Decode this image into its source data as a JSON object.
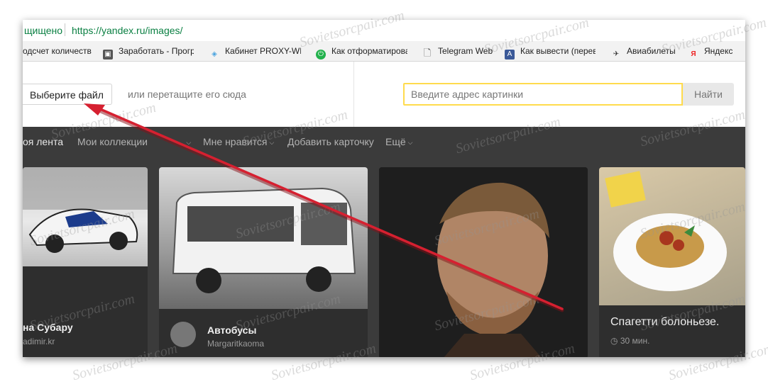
{
  "browser": {
    "secure_text": "щищено",
    "url": "https://yandex.ru/images/"
  },
  "bookmarks": [
    {
      "label": "одсчет количеств",
      "icon": "none"
    },
    {
      "label": "Заработать - Прогр",
      "icon": "page-icon"
    },
    {
      "label": "Кабинет PROXY-WE",
      "icon": "cube-icon"
    },
    {
      "label": "Как отформатирова",
      "icon": "power-icon"
    },
    {
      "label": "Telegram Web",
      "icon": "document-icon"
    },
    {
      "label": "Как вывести (перев",
      "icon": "a-letter-icon"
    },
    {
      "label": "Авиабилеты",
      "icon": "plane-icon"
    },
    {
      "label": "Яндекс",
      "icon": "yandex-icon"
    }
  ],
  "upload": {
    "choose_file_label": "Выберите файл",
    "drag_hint": "или перетащите его сюда"
  },
  "url_search": {
    "placeholder": "Введите адрес картинки",
    "button_label": "Найти"
  },
  "tabs": [
    {
      "label": "оя лента",
      "active": true
    },
    {
      "label": "Мои коллекции"
    },
    {
      "label": "Мне нравится"
    },
    {
      "label": "Добавить карточку"
    },
    {
      "label": "Ещё"
    }
  ],
  "cards": [
    {
      "title": "на Субару",
      "subtitle": "adimir.kr"
    },
    {
      "title": "Автобусы",
      "subtitle": "Margaritkaoma"
    },
    {
      "title": "",
      "subtitle": ""
    },
    {
      "title": "Спагетти болоньезе.",
      "subtitle": "30 мин."
    }
  ],
  "watermark": "Sovietsorcpair.com",
  "colors": {
    "secure_green": "#0b8043",
    "input_border": "#ffdb4d",
    "feed_bg": "#3b3b3b",
    "arrow": "#d62030"
  }
}
